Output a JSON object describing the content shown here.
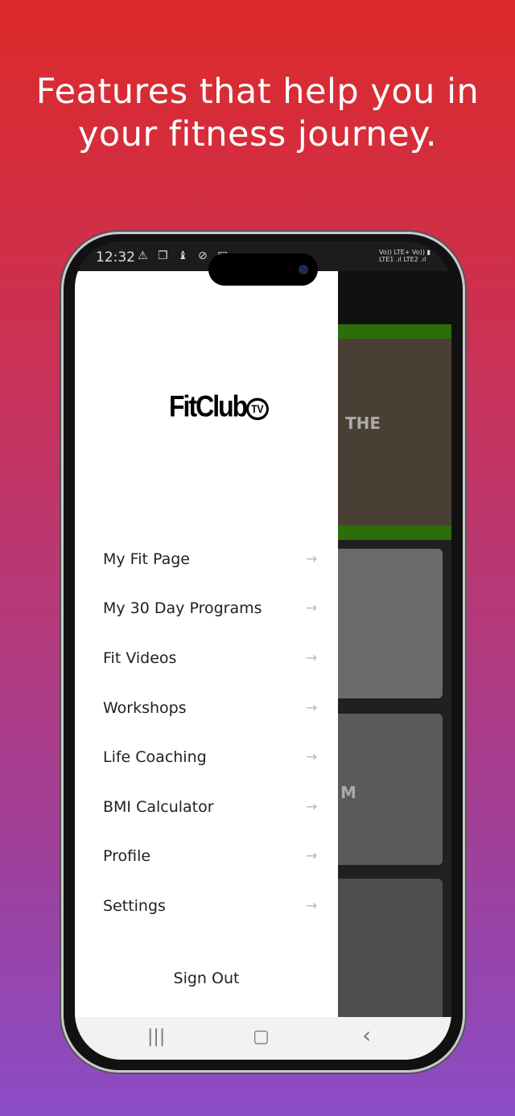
{
  "headline": "Features that help you in your fitness journey.",
  "status_bar": {
    "time": "12:32",
    "icons": [
      "warning-icon",
      "copy-icon",
      "notification-icon",
      "link-icon",
      "image-icon"
    ],
    "right_text": [
      "Vo)) LTE+",
      "LTE1",
      "Vo))",
      "LTE2"
    ]
  },
  "drawer": {
    "logo": "FitClub",
    "logo_badge": "TV",
    "items": [
      {
        "label": "My Fit Page"
      },
      {
        "label": "My 30 Day Programs"
      },
      {
        "label": "Fit Videos"
      },
      {
        "label": "Workshops"
      },
      {
        "label": "Life Coaching"
      },
      {
        "label": "BMI Calculator"
      },
      {
        "label": "Profile"
      },
      {
        "label": "Settings"
      }
    ],
    "arrow": "→",
    "sign_out": "Sign Out"
  },
  "background": {
    "banner_text": "THE",
    "card_text": "M"
  },
  "navbar": {
    "recents": "|||",
    "home": "▢",
    "back": "‹"
  }
}
